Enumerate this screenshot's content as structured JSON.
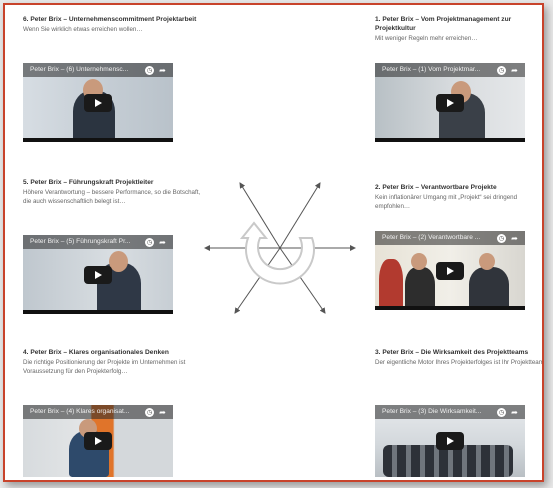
{
  "cards": {
    "c6": {
      "title": "6. Peter Brix – Unternehmenscommitment Projektarbeit",
      "desc": "Wenn Sie wirklich etwas erreichen wollen…",
      "video_caption": "Peter Brix – (6) Unternehmensc..."
    },
    "c1": {
      "title": "1. Peter Brix – Vom Projektmanagement zur Projektkultur",
      "desc": "Mit weniger Regeln mehr erreichen…",
      "video_caption": "Peter Brix – (1) Vom Projektmar..."
    },
    "c5": {
      "title": "5. Peter Brix – Führungskraft Projektleiter",
      "desc": "Höhere Verantwortung – bessere Performance, so die Botschaft, die auch wissenschaftlich belegt ist…",
      "video_caption": "Peter Brix – (5) Führungskraft Pr..."
    },
    "c2": {
      "title": "2. Peter Brix – Verantwortbare Projekte",
      "desc": "Kein inflationärer Umgang mit „Projekt“ sei dringend empfohlen…",
      "video_caption": "Peter Brix – (2) Verantwortbare ..."
    },
    "c4": {
      "title": "4. Peter Brix – Klares organisationales Denken",
      "desc": "Die richtige Positionierung der Projekte im Unternehmen ist Voraussetzung für den Projekterfolg…",
      "video_caption": "Peter Brix – (4) Klares organisat..."
    },
    "c3": {
      "title": "3. Peter Brix – Die Wirksamkeit des Projektteams",
      "desc": "Der eigentliche Motor Ihres Projekterfolges ist Ihr Projektteam…",
      "video_caption": "Peter Brix – (3) Die Wirksamkeit..."
    }
  },
  "icons": {
    "clock": "clock-icon",
    "share": "share-icon",
    "play": "play-icon"
  },
  "colors": {
    "frame_border": "#c8432b",
    "title_text": "#333333",
    "desc_text": "#666666"
  }
}
